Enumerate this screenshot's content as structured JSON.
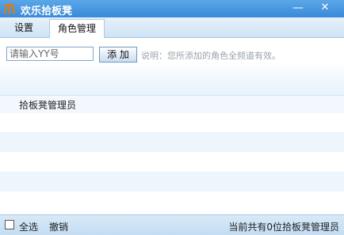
{
  "window": {
    "title": "欢乐拾板凳",
    "minimize": "—",
    "close": "✕"
  },
  "tabs": [
    {
      "label": "设置"
    },
    {
      "label": "角色管理"
    }
  ],
  "panel": {
    "input_placeholder": "请输入YY号",
    "add_label": "添 加",
    "hint": "说明：您所添加的角色全频道有效。"
  },
  "list": {
    "header": "拾板凳管理员"
  },
  "footer": {
    "select_all": "全选",
    "revoke": "撤销",
    "count_text": "当前共有0位拾板凳管理员"
  }
}
